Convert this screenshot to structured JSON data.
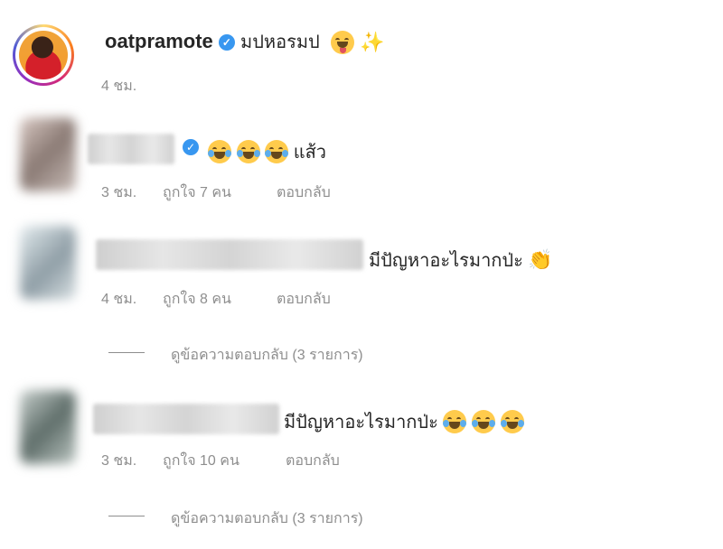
{
  "caption": {
    "username": "oatpramote",
    "text": "มปหอรมป",
    "time": "4 ชม."
  },
  "comments": [
    {
      "text": "แส้ว",
      "time": "3 ชม.",
      "likes": "ถูกใจ 7 คน",
      "reply": "ตอบกลับ",
      "view_replies": ""
    },
    {
      "text": "มีปัญหาอะไรมากป่ะ",
      "time": "4 ชม.",
      "likes": "ถูกใจ 8 คน",
      "reply": "ตอบกลับ",
      "view_replies": "ดูข้อความตอบกลับ (3 รายการ)"
    },
    {
      "text": "มีปัญหาอะไรมากป่ะ",
      "time": "3 ชม.",
      "likes": "ถูกใจ 10 คน",
      "reply": "ตอบกลับ",
      "view_replies": "ดูข้อความตอบกลับ (3 รายการ)"
    }
  ],
  "colors": {
    "verified": "#3897f0",
    "meta": "#8e8e8e",
    "text": "#262626"
  },
  "icons": [
    "verified-badge-icon",
    "squinting-tongue-emoji-icon",
    "sparkles-emoji-icon",
    "tears-of-joy-emoji-icon",
    "clapping-hands-emoji-icon"
  ]
}
